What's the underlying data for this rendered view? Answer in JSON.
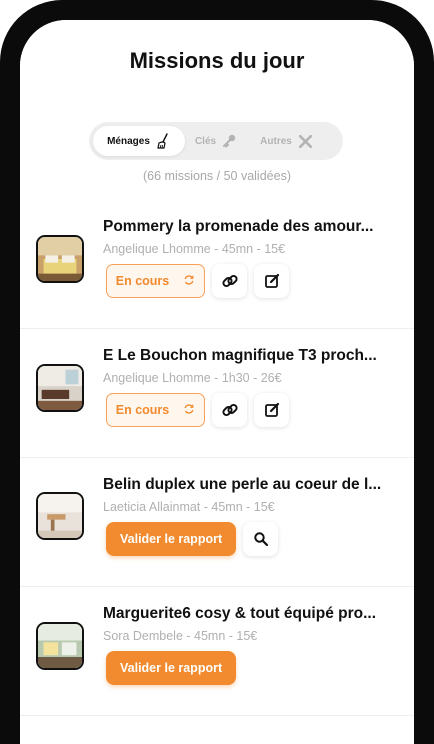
{
  "header": {
    "title": "Missions du jour"
  },
  "tabs": [
    {
      "label": "Ménages",
      "icon": "broom-icon",
      "active": true
    },
    {
      "label": "Clés",
      "icon": "key-icon",
      "active": false
    },
    {
      "label": "Autres",
      "icon": "tools-icon",
      "active": false
    }
  ],
  "summary": "(66 missions / 50 validées)",
  "missions": [
    {
      "title": "Pommery la promenade des amour...",
      "subtitle": "Angelique Lhomme - 45mn - 15€",
      "status_label": "En cours"
    },
    {
      "title": "E Le Bouchon magnifique T3 proch...",
      "subtitle": "Angelique Lhomme - 1h30 - 26€",
      "status_label": "En cours"
    },
    {
      "title": "Belin duplex une perle au coeur de l...",
      "subtitle": "Laeticia Allainmat - 45mn - 15€",
      "action_label": "Valider le rapport"
    },
    {
      "title": "Marguerite6 cosy & tout équipé pro...",
      "subtitle": "Sora Dembele - 45mn - 15€",
      "action_label": "Valider le rapport"
    }
  ],
  "colors": {
    "accent": "#f28b2f",
    "accent_light": "#fff6ee",
    "text": "#111111",
    "muted": "#b0b0b0"
  }
}
